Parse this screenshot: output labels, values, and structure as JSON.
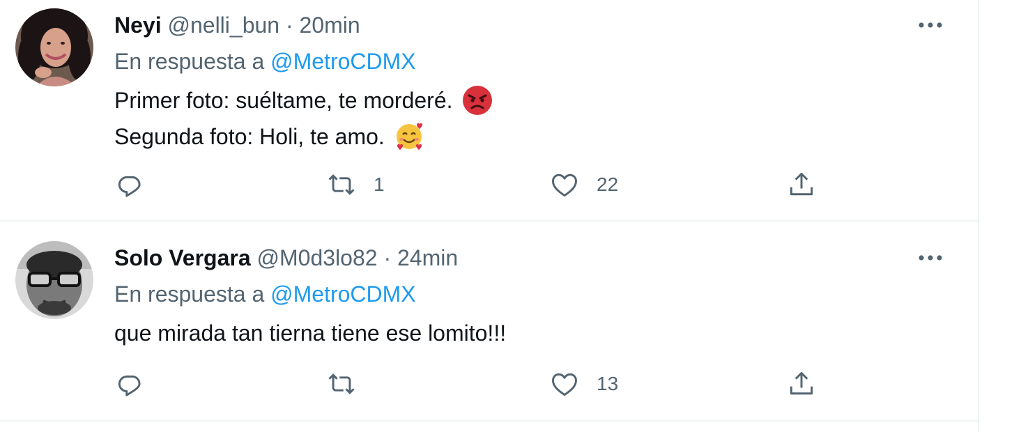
{
  "tweets": [
    {
      "name": "Neyi",
      "handle": "@nelli_bun",
      "separator": "·",
      "time": "20min",
      "reply_prefix": "En respuesta a",
      "reply_mention": "@MetroCDMX",
      "lines": [
        "Primer foto: suéltame, te morderé.",
        "Segunda foto: Holi, te amo."
      ],
      "retweets": "1",
      "likes": "22"
    },
    {
      "name": "Solo Vergara",
      "handle": "@M0d3lo82",
      "separator": "·",
      "time": "24min",
      "reply_prefix": "En respuesta a",
      "reply_mention": "@MetroCDMX",
      "lines": [
        "que mirada tan tierna tiene ese lomito!!!"
      ],
      "retweets": "",
      "likes": "13"
    }
  ],
  "icons": {
    "more": "more-horizontal-icon",
    "reply": "reply-bubble-icon",
    "retweet": "retweet-icon",
    "like": "heart-icon",
    "share": "share-upload-icon",
    "emoji_1": "angry-face-emoji",
    "emoji_2": "smiling-face-with-hearts-emoji"
  },
  "colors": {
    "text": "#0f1419",
    "muted": "#536471",
    "accent": "#1d9bf0",
    "divider": "#eff3f4"
  }
}
